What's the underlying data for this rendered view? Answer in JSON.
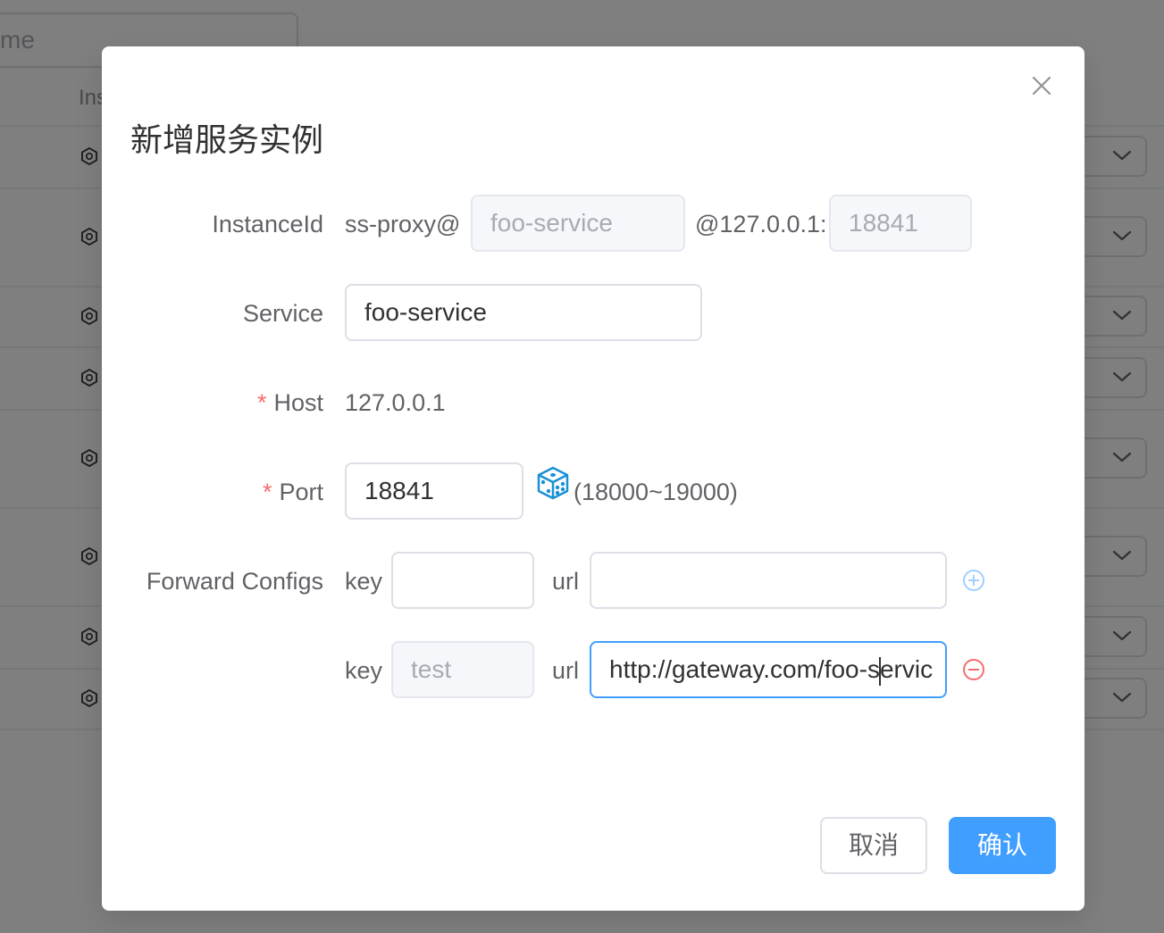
{
  "background": {
    "search_placeholder": "me",
    "table_header_col": "Ins",
    "rows": [
      {
        "icon": "instance-icon"
      },
      {
        "icon": "instance-icon"
      },
      {
        "icon": "instance-icon"
      },
      {
        "icon": "instance-icon"
      },
      {
        "icon": "instance-icon"
      },
      {
        "icon": "instance-icon"
      },
      {
        "icon": "instance-icon"
      },
      {
        "icon": "instance-icon"
      }
    ]
  },
  "dialog": {
    "title": "新增服务实例",
    "close_icon": "close-icon",
    "instance_id": {
      "label": "InstanceId",
      "prefix": "ss-proxy@",
      "service_value": "foo-service",
      "middle": "@127.0.0.1:",
      "port_value": "18841"
    },
    "service": {
      "label": "Service",
      "value": "foo-service"
    },
    "host": {
      "required_mark": "*",
      "label": "Host",
      "value": "127.0.0.1"
    },
    "port": {
      "required_mark": "*",
      "label": "Port",
      "value": "18841",
      "dice_icon": "dice-icon",
      "range": "(18000~19000)"
    },
    "forward_configs": {
      "label": "Forward Configs",
      "rows": [
        {
          "key_label": "key",
          "key_value": "",
          "url_label": "url",
          "url_value": "",
          "action_icon": "add-circle-icon"
        },
        {
          "key_label": "key",
          "key_value": "test",
          "url_label": "url",
          "url_value_before_caret": "http://gateway.com/foo-s",
          "url_value_after_caret": "ervic",
          "action_icon": "remove-circle-icon"
        }
      ]
    },
    "buttons": {
      "cancel": "取消",
      "confirm": "确认"
    },
    "colors": {
      "primary": "#409eff",
      "danger": "#f56c6c",
      "add_icon": "#a0cfff"
    }
  }
}
